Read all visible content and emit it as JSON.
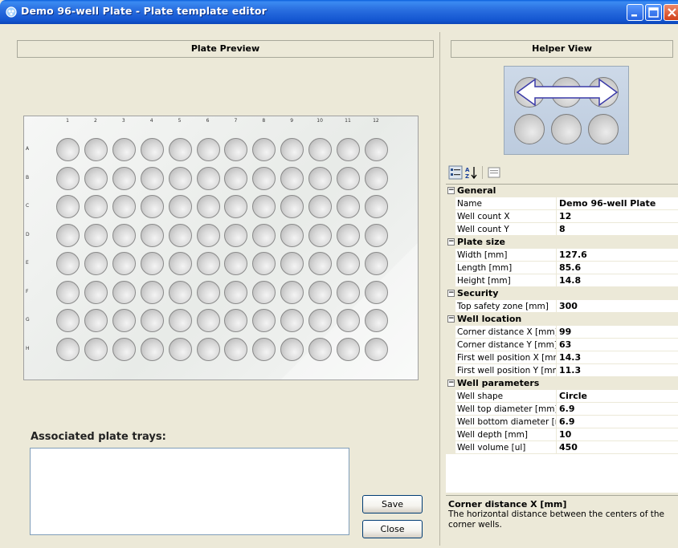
{
  "window": {
    "title": "Demo 96-well Plate - Plate template editor",
    "minimize_glyph": "_",
    "maximize_glyph": "□",
    "close_glyph": "X"
  },
  "left_panel": {
    "header": "Plate Preview",
    "plate": {
      "columns": [
        "1",
        "2",
        "3",
        "4",
        "5",
        "6",
        "7",
        "8",
        "9",
        "10",
        "11",
        "12"
      ],
      "rows": [
        "A",
        "B",
        "C",
        "D",
        "E",
        "F",
        "G",
        "H"
      ]
    },
    "associated_label": "Associated plate trays:",
    "save_label": "Save",
    "close_label": "Close"
  },
  "right_panel": {
    "header": "Helper View",
    "toolbar": {
      "categorized_icon": "categorized-icon",
      "alphabetical_icon": "sort-az-icon",
      "property_pages_icon": "property-pages-icon"
    },
    "properties": {
      "general": {
        "category": "General",
        "name_label": "Name",
        "name_value": "Demo 96-well Plate",
        "wcx_label": "Well count X",
        "wcx_value": "12",
        "wcy_label": "Well count Y",
        "wcy_value": "8"
      },
      "plate_size": {
        "category": "Plate size",
        "width_label": "Width [mm]",
        "width_value": "127.6",
        "length_label": "Length [mm]",
        "length_value": "85.6",
        "height_label": "Height [mm]",
        "height_value": "14.8"
      },
      "security": {
        "category": "Security",
        "tsz_label": "Top safety zone [mm]",
        "tsz_value": "300"
      },
      "well_location": {
        "category": "Well location",
        "cdx_label": "Corner distance X [mm]",
        "cdx_value": "99",
        "cdy_label": "Corner distance Y [mm]",
        "cdy_value": "63",
        "fwx_label": "First well position X [mm]",
        "fwx_value": "14.3",
        "fwy_label": "First well position Y [mm]",
        "fwy_value": "11.3"
      },
      "well_parameters": {
        "category": "Well parameters",
        "shape_label": "Well shape",
        "shape_value": "Circle",
        "top_label": "Well top diameter [mm]",
        "top_value": "6.9",
        "bottom_label": "Well bottom diameter [mm]",
        "bottom_value": "6.9",
        "depth_label": "Well depth [mm]",
        "depth_value": "10",
        "volume_label": "Well volume [ul]",
        "volume_value": "450"
      }
    },
    "description": {
      "title": "Corner distance X [mm]",
      "text": "The horizontal distance between the centers of the corner wells."
    }
  },
  "colors": {
    "titlebar": "#2a6fe0",
    "window_bg": "#ece9d8"
  }
}
